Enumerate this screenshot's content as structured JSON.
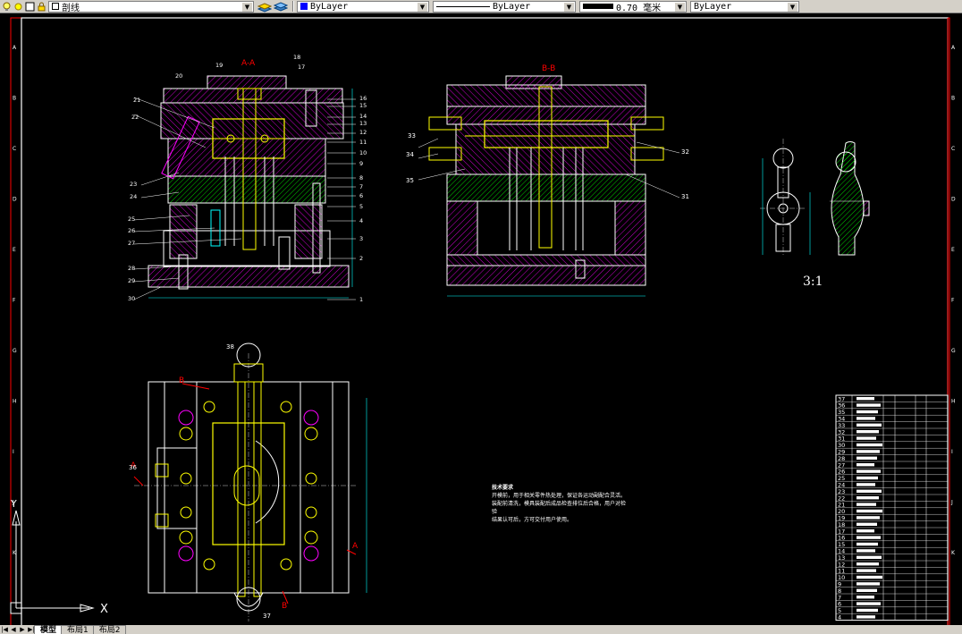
{
  "toolbar": {
    "layer_name": "剖线",
    "color_value": "ByLayer",
    "linetype_value": "ByLayer",
    "lineweight_value": "0.70 毫米",
    "plotstyle_value": "ByLayer"
  },
  "tabs": [
    "模型",
    "布局1",
    "布局2"
  ],
  "active_tab": "模型",
  "border": {
    "row_letters": [
      "A",
      "B",
      "C",
      "D",
      "E",
      "F",
      "G",
      "H",
      "I",
      "J",
      "K"
    ]
  },
  "section_labels": {
    "aa": "A-A",
    "bb": "B-B",
    "detail_scale": "3:1"
  },
  "view_markers": {
    "a": "A",
    "b": "B"
  },
  "part_numbers_left": [
    "21",
    "22",
    "23",
    "24",
    "25",
    "26",
    "27",
    "28",
    "29",
    "30"
  ],
  "part_numbers_right": [
    "19",
    "20",
    "18",
    "17",
    "16",
    "15",
    "14",
    "13",
    "12",
    "11",
    "10",
    "9",
    "8",
    "7",
    "6",
    "5",
    "4",
    "3",
    "2",
    "1"
  ],
  "part_numbers_bb": [
    "33",
    "34",
    "35",
    "32",
    "31"
  ],
  "part_numbers_plan": [
    "36",
    "37",
    "38"
  ],
  "notes": {
    "title": "技术要求",
    "lines": [
      "开模前，用于相关零件热处理，保证各运动副配合灵活。",
      "装配前清洗，模具装配后成品检查排位后合格，用户对检验",
      "结果认可后，方可交付用户使用。"
    ]
  },
  "bom_rows": [
    "37",
    "36",
    "35",
    "34",
    "33",
    "32",
    "31",
    "30",
    "29",
    "28",
    "27",
    "26",
    "25",
    "24",
    "23",
    "22",
    "21",
    "20",
    "19",
    "18",
    "17",
    "16",
    "15",
    "14",
    "13",
    "12",
    "11",
    "10",
    "9",
    "8",
    "7",
    "6",
    "5",
    "4"
  ],
  "colors": {
    "background": "#000000",
    "outline": "#ffffff",
    "hatch": "#ff00ff",
    "accent_yellow": "#ffff00",
    "accent_green": "#00ff00",
    "accent_red": "#ff0000",
    "accent_cyan": "#00ffff",
    "border_red": "#ff0000",
    "toolbar": "#d4d0c8"
  }
}
